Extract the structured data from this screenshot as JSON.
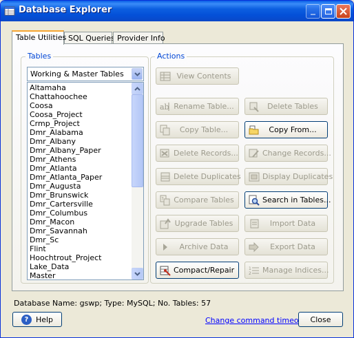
{
  "window": {
    "title": "Database Explorer",
    "title_icon": "database-explorer-icon",
    "controls": [
      "minimize",
      "maximize",
      "close"
    ]
  },
  "tabs": [
    {
      "label": "Table Utilities",
      "active": true
    },
    {
      "label": "SQL Queries",
      "active": false
    },
    {
      "label": "Provider Info",
      "active": false
    }
  ],
  "tables": {
    "group_label": "Tables",
    "filter_selected": "Working & Master Tables",
    "items": [
      "Altamaha",
      "Chattahoochee",
      "Coosa",
      "Coosa_Project",
      "Crmp_Project",
      "Dmr_Alabama",
      "Dmr_Albany",
      "Dmr_Albany_Paper",
      "Dmr_Athens",
      "Dmr_Atlanta",
      "Dmr_Atlanta_Paper",
      "Dmr_Augusta",
      "Dmr_Brunswick",
      "Dmr_Cartersville",
      "Dmr_Columbus",
      "Dmr_Macon",
      "Dmr_Savannah",
      "Dmr_Sc",
      "Flint",
      "Hoochtrout_Project",
      "Lake_Data",
      "Master"
    ]
  },
  "actions": {
    "group_label": "Actions",
    "view_contents": {
      "label": "View Contents",
      "icon": "table-grid-icon"
    },
    "rename_table": {
      "label": "Rename Table...",
      "icon": "rename-icon"
    },
    "delete_tables": {
      "label": "Delete Tables",
      "icon": "delete-table-icon"
    },
    "copy_table": {
      "label": "Copy Table...",
      "icon": "copy-icon"
    },
    "copy_from": {
      "label": "Copy From...",
      "icon": "folder-icon"
    },
    "delete_records": {
      "label": "Delete Records...",
      "icon": "delete-records-icon"
    },
    "change_records": {
      "label": "Change Records...",
      "icon": "edit-records-icon"
    },
    "delete_duplicates": {
      "label": "Delete Duplicates",
      "icon": "duplicates-icon"
    },
    "display_duplicates": {
      "label": "Display Duplicates",
      "icon": "display-duplicates-icon"
    },
    "compare_tables": {
      "label": "Compare Tables",
      "icon": "compare-icon"
    },
    "search_in_tables": {
      "label": "Search in Tables...",
      "icon": "search-icon"
    },
    "upgrade_tables": {
      "label": "Upgrade Tables",
      "icon": "upgrade-icon"
    },
    "import_data": {
      "label": "Import Data",
      "icon": "import-icon"
    },
    "archive_data": {
      "label": "Archive Data",
      "icon": "archive-arrow-icon"
    },
    "export_data": {
      "label": "Export Data",
      "icon": "export-arrows-icon"
    },
    "compact_repair": {
      "label": "Compact/Repair",
      "icon": "compact-repair-icon"
    },
    "manage_indices": {
      "label": "Manage Indices...",
      "icon": "indices-icon"
    }
  },
  "status": {
    "text": "Database Name: gswp; Type: MySQL; No. Tables: 57"
  },
  "footer": {
    "help_label": "Help",
    "timeout_link": "Change command timeout",
    "close_label": "Close"
  },
  "colors": {
    "titlebar": "#0450d8",
    "group_label": "#0046d5",
    "link": "#0000ff",
    "tab_highlight": "#f7a531"
  }
}
